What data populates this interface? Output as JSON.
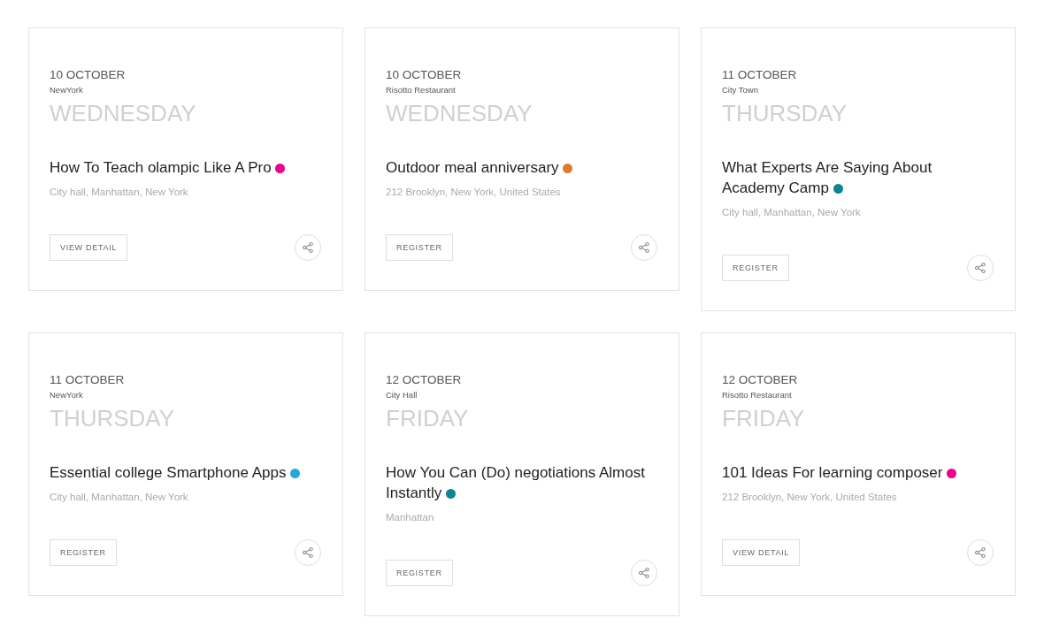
{
  "events": [
    {
      "date": "10 OCTOBER",
      "venue": "NewYork",
      "weekday": "WEDNESDAY",
      "title": "How To Teach olampic Like A Pro",
      "color": "#ec008c",
      "address": "City hall, Manhattan, New York",
      "button": "VIEW DETAIL"
    },
    {
      "date": "10 OCTOBER",
      "venue": "Risotto Restaurant",
      "weekday": "WEDNESDAY",
      "title": "Outdoor meal anniversary",
      "color": "#e07b2c",
      "address": "212 Brooklyn, New York, United States",
      "button": "REGISTER"
    },
    {
      "date": "11 OCTOBER",
      "venue": "City Town",
      "weekday": "THURSDAY",
      "title": "What Experts Are Saying About Academy Camp",
      "color": "#0b8592",
      "address": "City hall, Manhattan, New York",
      "button": "REGISTER"
    },
    {
      "date": "11 OCTOBER",
      "venue": "NewYork",
      "weekday": "THURSDAY",
      "title": "Essential college Smartphone Apps",
      "color": "#27a7dc",
      "address": "City hall, Manhattan, New York",
      "button": "REGISTER"
    },
    {
      "date": "12 OCTOBER",
      "venue": "City Hall",
      "weekday": "FRIDAY",
      "title": "How You Can (Do) negotiations Almost Instantly",
      "color": "#0b8592",
      "address": "Manhattan",
      "button": "REGISTER"
    },
    {
      "date": "12 OCTOBER",
      "venue": "Risotto Restaurant",
      "weekday": "FRIDAY",
      "title": "101 Ideas For learning composer",
      "color": "#ec008c",
      "address": "212 Brooklyn, New York, United States",
      "button": "VIEW DETAIL"
    }
  ]
}
